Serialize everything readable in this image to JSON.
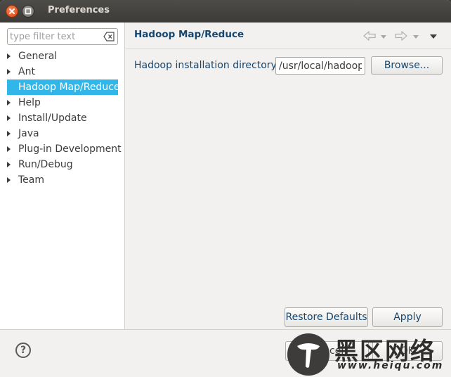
{
  "window": {
    "title": "Preferences"
  },
  "filter": {
    "placeholder": "type filter text"
  },
  "tree": {
    "items": [
      {
        "label": "General"
      },
      {
        "label": "Ant"
      },
      {
        "label": "Hadoop Map/Reduce",
        "selected": true
      },
      {
        "label": "Help"
      },
      {
        "label": "Install/Update"
      },
      {
        "label": "Java"
      },
      {
        "label": "Plug-in Development"
      },
      {
        "label": "Run/Debug"
      },
      {
        "label": "Team"
      }
    ]
  },
  "page": {
    "title": "Hadoop Map/Reduce",
    "install_dir_label": "Hadoop installation directory:",
    "install_dir_value": "/usr/local/hadoop",
    "browse_label": "Browse...",
    "restore_label": "Restore Defaults",
    "apply_label": "Apply"
  },
  "footer": {
    "help_icon": "?",
    "cancel_label": "Cancel",
    "ok_label": "OK"
  },
  "watermark": {
    "text": "黑区网络",
    "url": "www.heiqu.com"
  },
  "colors": {
    "selection": "#30b6e8",
    "title_text": "#16456e",
    "titlebar": "#3c3b37",
    "close_button": "#df4b16"
  }
}
